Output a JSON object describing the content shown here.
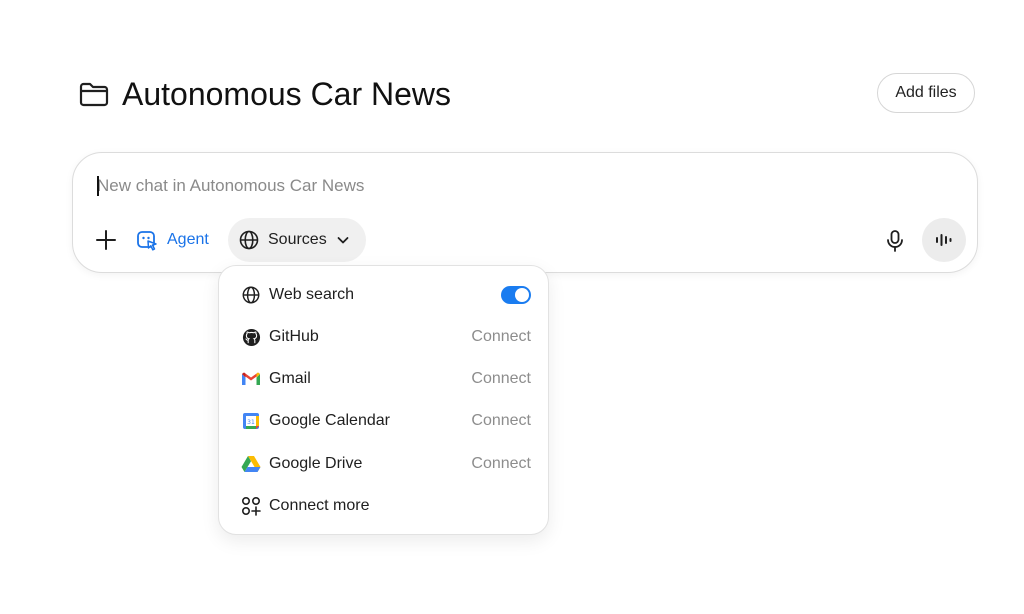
{
  "header": {
    "title": "Autonomous Car News",
    "add_files_label": "Add files",
    "folder_icon": "folder-icon"
  },
  "composer": {
    "placeholder": "New chat in Autonomous Car News",
    "agent_label": "Agent",
    "sources_label": "Sources",
    "accent_color": "#1a73e8"
  },
  "sources_menu": {
    "items": [
      {
        "label": "Web search",
        "icon": "globe-icon",
        "toggle_on": true
      },
      {
        "label": "GitHub",
        "icon": "github-icon",
        "action": "Connect"
      },
      {
        "label": "Gmail",
        "icon": "gmail-icon",
        "action": "Connect"
      },
      {
        "label": "Google Calendar",
        "icon": "google-calendar-icon",
        "action": "Connect"
      },
      {
        "label": "Google Drive",
        "icon": "google-drive-icon",
        "action": "Connect"
      },
      {
        "label": "Connect more",
        "icon": "apps-grid-icon"
      }
    ],
    "toggle_color": "#1a7cf0"
  }
}
